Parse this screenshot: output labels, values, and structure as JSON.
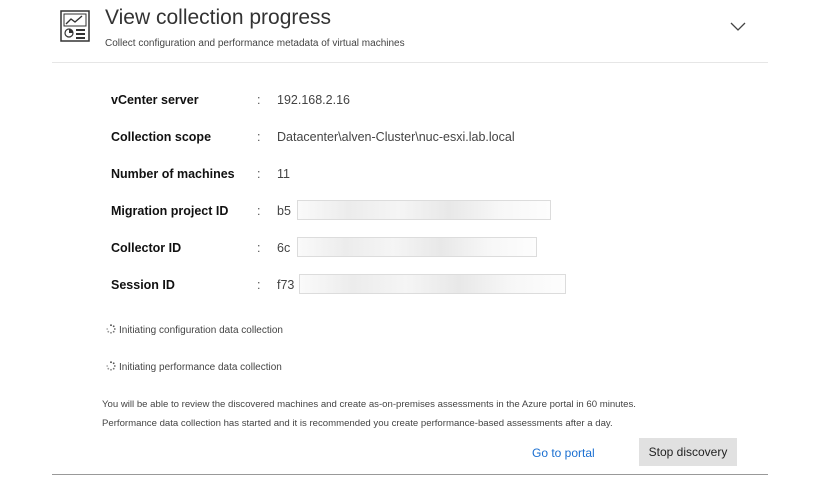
{
  "header": {
    "title": "View collection progress",
    "subtitle": "Collect configuration and performance metadata of virtual machines",
    "icon": "report-chart-icon",
    "collapse_icon": "chevron-down-icon"
  },
  "details": [
    {
      "label": "vCenter server",
      "sep": ":",
      "value": "192.168.2.16"
    },
    {
      "label": "Collection scope",
      "sep": ":",
      "value": "Datacenter\\alven-Cluster\\nuc-esxi.lab.local"
    },
    {
      "label": "Number of machines",
      "sep": ":",
      "value": "11"
    },
    {
      "label": "Migration project ID",
      "sep": ":",
      "value": "b5"
    },
    {
      "label": "Collector ID",
      "sep": ":",
      "value": "6c"
    },
    {
      "label": "Session ID",
      "sep": ":",
      "value": "f73"
    }
  ],
  "status": [
    {
      "text": "Initiating configuration data collection",
      "icon": "spinner-icon"
    },
    {
      "text": "Initiating performance data collection",
      "icon": "spinner-icon"
    }
  ],
  "note": {
    "line1": "You will be able to review the discovered machines and create as-on-premises assessments in the Azure portal in 60 minutes.",
    "line2": "Performance data collection has started and it is recommended you create performance-based assessments after a day."
  },
  "actions": {
    "portal_link": "Go to portal",
    "stop_button": "Stop discovery"
  },
  "colors": {
    "link": "#1a6fd1",
    "button_bg": "#e1e1e1"
  }
}
